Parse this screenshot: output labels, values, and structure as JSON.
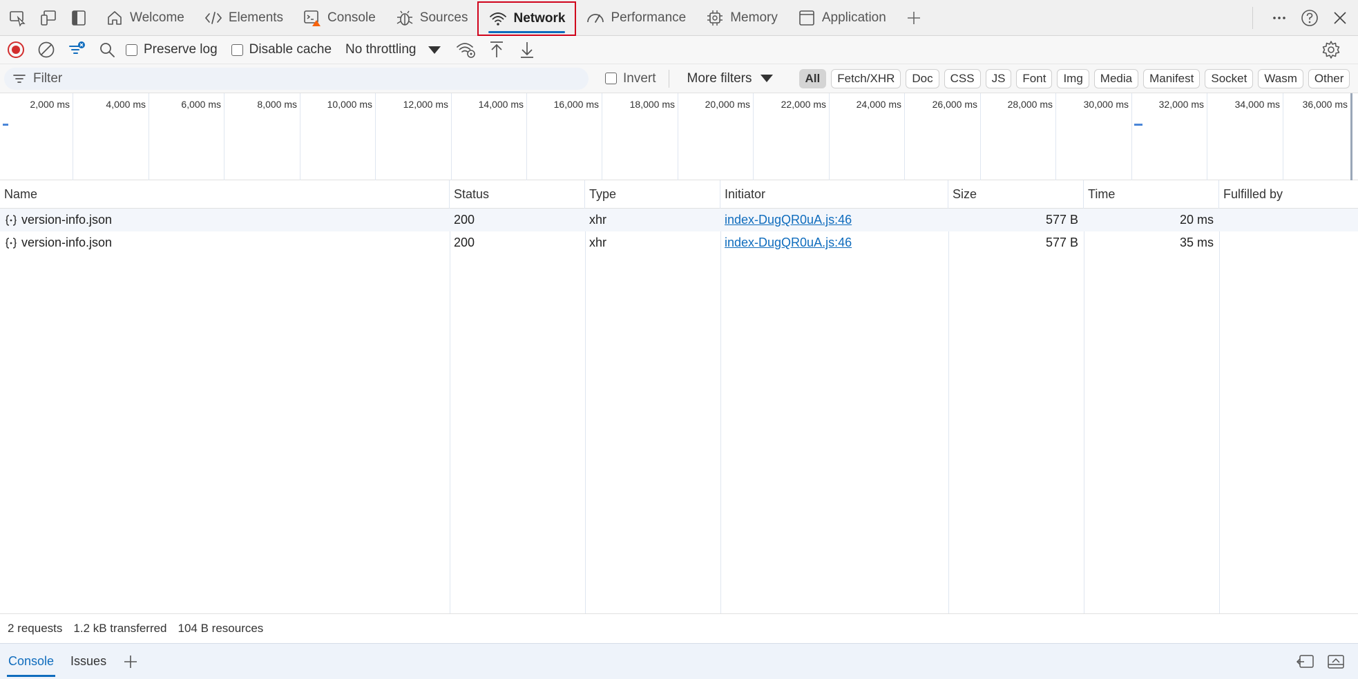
{
  "toolbar_left": {
    "icons": [
      "inspect-icon",
      "device-emulation-icon",
      "dock-icon"
    ]
  },
  "tabs": [
    {
      "label": "Welcome",
      "icon": "home-icon"
    },
    {
      "label": "Elements",
      "icon": "code-icon"
    },
    {
      "label": "Console",
      "icon": "console-warning-icon"
    },
    {
      "label": "Sources",
      "icon": "bug-icon"
    },
    {
      "label": "Network",
      "icon": "wifi-icon",
      "active": true
    },
    {
      "label": "Performance",
      "icon": "gauge-icon"
    },
    {
      "label": "Memory",
      "icon": "chip-icon"
    },
    {
      "label": "Application",
      "icon": "window-icon"
    }
  ],
  "network_toolbar": {
    "preserve_log": "Preserve log",
    "disable_cache": "Disable cache",
    "throttling": "No throttling"
  },
  "filter_bar": {
    "placeholder": "Filter",
    "invert": "Invert",
    "more_filters": "More filters",
    "chips": [
      "All",
      "Fetch/XHR",
      "Doc",
      "CSS",
      "JS",
      "Font",
      "Img",
      "Media",
      "Manifest",
      "Socket",
      "Wasm",
      "Other"
    ],
    "active_chip": "All"
  },
  "overview": {
    "ticks": [
      "2,000 ms",
      "4,000 ms",
      "6,000 ms",
      "8,000 ms",
      "10,000 ms",
      "12,000 ms",
      "14,000 ms",
      "16,000 ms",
      "18,000 ms",
      "20,000 ms",
      "22,000 ms",
      "24,000 ms",
      "26,000 ms",
      "28,000 ms",
      "30,000 ms",
      "32,000 ms",
      "34,000 ms",
      "36,000 ms"
    ]
  },
  "table": {
    "columns": [
      "Name",
      "Status",
      "Type",
      "Initiator",
      "Size",
      "Time",
      "Fulfilled by"
    ],
    "rows": [
      {
        "name": "version-info.json",
        "status": "200",
        "type": "xhr",
        "initiator": "index-DugQR0uA.js:46",
        "size": "577 B",
        "time": "20 ms",
        "fulfilled": ""
      },
      {
        "name": "version-info.json",
        "status": "200",
        "type": "xhr",
        "initiator": "index-DugQR0uA.js:46",
        "size": "577 B",
        "time": "35 ms",
        "fulfilled": ""
      }
    ]
  },
  "summary": {
    "requests": "2 requests",
    "transferred": "1.2 kB transferred",
    "resources": "104 B resources"
  },
  "drawer": {
    "tabs": [
      "Console",
      "Issues"
    ],
    "active": "Console"
  },
  "colors": {
    "accent": "#0f6cbd",
    "highlight_border": "#d0021b",
    "record_red": "#d22d2d"
  }
}
